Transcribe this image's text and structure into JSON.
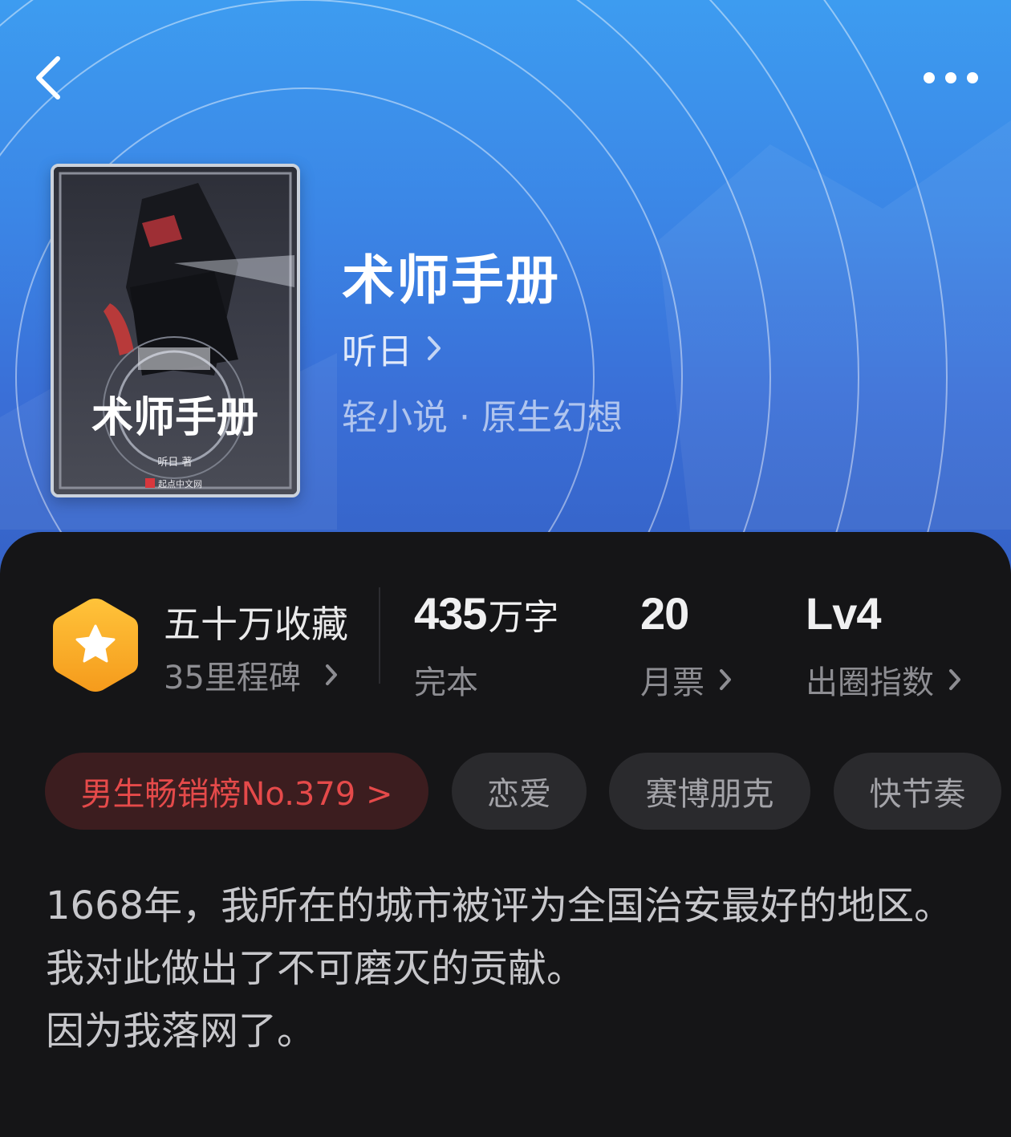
{
  "header": {
    "back_icon": "chevron-left-icon",
    "more_icon": "more-horizontal-icon"
  },
  "book": {
    "title": "术师手册",
    "author": "听日",
    "genre_line": "轻小说 · 原生幻想",
    "cover": {
      "title_art": "术师手册",
      "author_line": "听日  著",
      "publisher": "起点中文网"
    }
  },
  "stats": {
    "collections": {
      "label": "五十万收藏",
      "sub": "35里程碑",
      "badge_icon": "star-hexagon-icon"
    },
    "words": {
      "number": "435",
      "unit": "万字",
      "sub": "完本"
    },
    "monthly_votes": {
      "number": "20",
      "sub": "月票"
    },
    "influence": {
      "number": "Lv4",
      "sub": "出圈指数"
    }
  },
  "tags": [
    {
      "label": "男生畅销榜No.379 >"
    },
    {
      "label": "恋爱"
    },
    {
      "label": "赛博朋克"
    },
    {
      "label": "快节奏"
    }
  ],
  "synopsis": {
    "lines": [
      "1668年，我所在的城市被评为全国治安最好的地区。",
      "我对此做出了不可磨灭的贡献。",
      "因为我落网了。"
    ]
  },
  "colors": {
    "hero_top": "#3d9cf0",
    "hero_bottom": "#3560c4",
    "panel_bg": "#151517",
    "rank_tag_text": "#e54a4a",
    "badge_orange": "#f5a623"
  }
}
